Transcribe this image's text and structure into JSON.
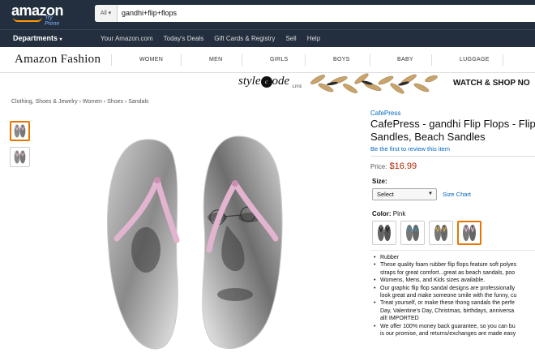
{
  "header": {
    "logo_text": "amazon",
    "logo_sub": "Try Prime",
    "search_category": "All",
    "search_value": "gandhi+flip+flops"
  },
  "nav": {
    "departments": "Departments",
    "links": [
      "Your Amazon.com",
      "Today's Deals",
      "Gift Cards & Registry",
      "Sell",
      "Help"
    ]
  },
  "fashion": {
    "title": "Amazon Fashion",
    "categories": [
      "WOMEN",
      "MEN",
      "GIRLS",
      "BOYS",
      "BABY",
      "LUGGAGE"
    ]
  },
  "banner": {
    "brand_pre": "style",
    "brand_post": "ode",
    "brand_live": "LIVE",
    "cta": "WATCH & SHOP NO"
  },
  "breadcrumb": "Clothing, Shoes & Jewelry › Women › Shoes › Sandals",
  "product": {
    "brand": "CafePress",
    "title_line1": "CafePress - gandhi Flip Flops - Flip",
    "title_line2": "Sandles, Beach Sandles",
    "review_link": "Be the first to review this item",
    "price_label": "Price:",
    "price": "$16.99",
    "size_label": "Size:",
    "size_selected": "Select",
    "size_chart": "Size Chart",
    "color_label": "Color:",
    "color_value": "Pink",
    "bullets": [
      "Rubber",
      "These quality foam rubber flip flops feature soft polyes",
      "straps for great comfort...great as beach sandals, poo",
      "Womens, Mens, and Kids sizes available.",
      "Our graphic flip flop sandal designs are professionally",
      "look great and make someone smile with the funny, cu",
      "Treat yourself, or make these thong sandals the perfe",
      "Day, Valentine's Day, Christmas, birthdays, anniversa",
      "all! IMPORTED",
      "We offer 100% money back guarantee, so you can bu",
      "is our promise, and returns/exchanges are made easy"
    ]
  },
  "colors": {
    "topbar": "#232f3e",
    "accent": "#e77600",
    "price": "#b12704",
    "link": "#0066c0",
    "strap": "#e2b4cf"
  }
}
